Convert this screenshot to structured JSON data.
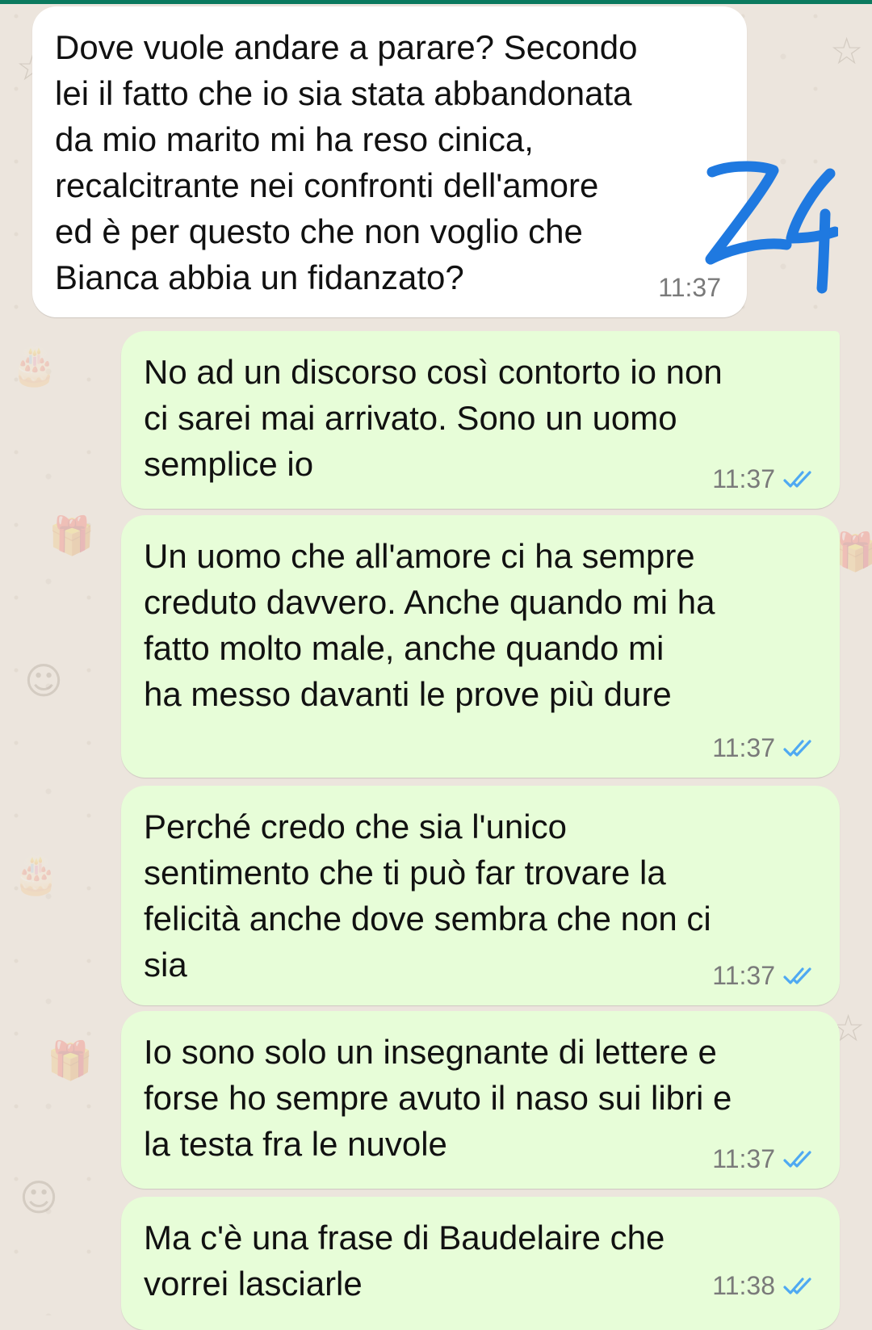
{
  "chat": {
    "colors": {
      "incoming_bubble": "#ffffff",
      "outgoing_bubble": "#e7fdd8",
      "read_ticks": "#4fa9f2",
      "annotation": "#1f79e0"
    },
    "annotation": {
      "text": "24"
    },
    "messages": [
      {
        "direction": "incoming",
        "text": "Dove vuole andare a parare? Secondo\nlei il fatto che io sia stata abbandonata\nda mio marito mi ha reso cinica,\nrecalcitrante nei confronti dell'amore\ned è per questo che non voglio che\nBianca abbia un fidanzato?",
        "time": "11:37"
      },
      {
        "direction": "outgoing",
        "text": "No ad un discorso così contorto io non\nci sarei mai arrivato. Sono un uomo\nsemplice io",
        "time": "11:37",
        "status_icon": "double-check-read-icon"
      },
      {
        "direction": "outgoing",
        "text": "Un uomo che all'amore ci ha sempre\ncreduto davvero. Anche quando mi ha\nfatto molto male, anche quando mi\nha messo davanti le prove più dure",
        "time": "11:37",
        "status_icon": "double-check-read-icon"
      },
      {
        "direction": "outgoing",
        "text": "Perché credo che sia l'unico\nsentimento che ti può far trovare la\nfelicità anche dove sembra che non ci\nsia",
        "time": "11:37",
        "status_icon": "double-check-read-icon"
      },
      {
        "direction": "outgoing",
        "text": "Io sono solo un insegnante di lettere e\nforse ho sempre avuto il naso sui libri e\nla testa fra le nuvole",
        "time": "11:37",
        "status_icon": "double-check-read-icon"
      },
      {
        "direction": "outgoing",
        "text": "Ma c'è una frase di Baudelaire che\nvorrei lasciarle",
        "time": "11:38",
        "status_icon": "double-check-read-icon"
      }
    ]
  }
}
